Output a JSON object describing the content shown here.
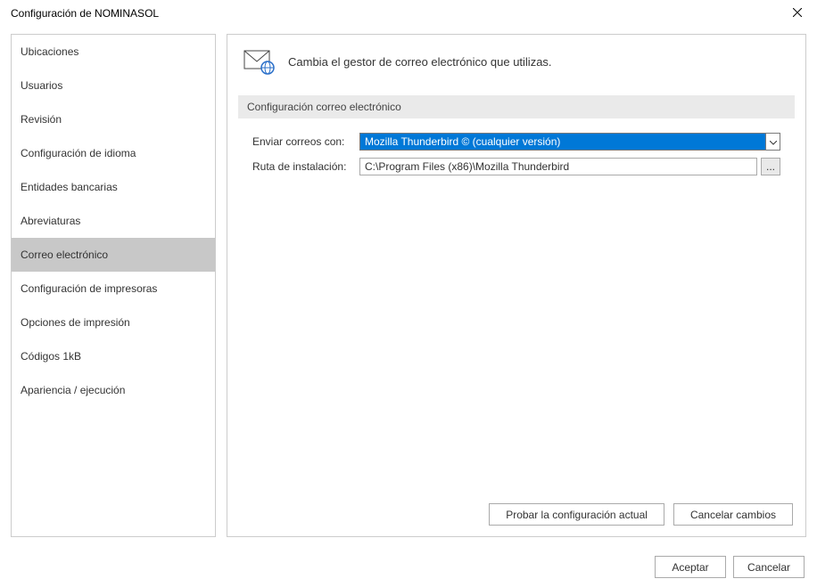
{
  "window": {
    "title": "Configuración de NOMINASOL"
  },
  "sidebar": {
    "items": [
      {
        "label": "Ubicaciones"
      },
      {
        "label": "Usuarios"
      },
      {
        "label": "Revisión"
      },
      {
        "label": "Configuración de idioma"
      },
      {
        "label": "Entidades bancarias"
      },
      {
        "label": "Abreviaturas"
      },
      {
        "label": "Correo electrónico"
      },
      {
        "label": "Configuración de impresoras"
      },
      {
        "label": "Opciones de impresión"
      },
      {
        "label": "Códigos 1kB"
      },
      {
        "label": "Apariencia / ejecución"
      }
    ],
    "active_index": 6
  },
  "main": {
    "header_text": "Cambia el gestor de correo electrónico que utilizas.",
    "section_title": "Configuración correo electrónico",
    "fields": {
      "send_with_label": "Enviar correos con:",
      "send_with_value": "Mozilla Thunderbird © (cualquier versión)",
      "install_path_label": "Ruta de instalación:",
      "install_path_value": "C:\\Program Files (x86)\\Mozilla Thunderbird",
      "browse_label": "..."
    },
    "inner_buttons": {
      "test_config": "Probar la configuración actual",
      "cancel_changes": "Cancelar cambios"
    }
  },
  "dialog_buttons": {
    "accept": "Aceptar",
    "cancel": "Cancelar"
  }
}
